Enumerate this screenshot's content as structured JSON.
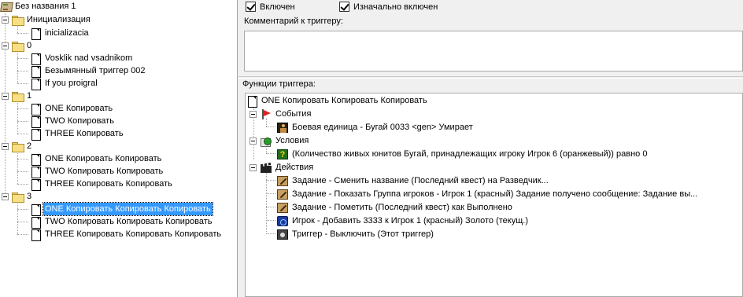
{
  "tree": {
    "map_name": "Без названия 1",
    "categories": [
      {
        "label": "Инициализация",
        "triggers": [
          "inicializacia"
        ]
      },
      {
        "label": "0",
        "triggers": [
          "Vosklik nad vsadnikom",
          "Безымянный триггер 002",
          "If you proigral"
        ]
      },
      {
        "label": "1",
        "triggers": [
          "ONE Копировать",
          "TWO Копировать",
          "THREE Копировать"
        ]
      },
      {
        "label": "2",
        "triggers": [
          "ONE Копировать Копировать",
          "TWO Копировать Копировать",
          "THREE Копировать Копировать"
        ]
      },
      {
        "label": "3",
        "triggers": [
          "ONE Копировать Копировать Копировать",
          "TWO Копировать Копировать Копировать",
          "THREE Копировать Копировать Копировать"
        ]
      }
    ],
    "selected": "ONE Копировать Копировать Копировать"
  },
  "editor": {
    "enabled_label": "Включен",
    "enabled_checked": true,
    "initially_on_label": "Изначально включен",
    "initially_on_checked": true,
    "comment_label": "Комментарий к триггеру:",
    "comment_value": "",
    "functions_label": "Функции триггера:",
    "trigger_name": "ONE Копировать Копировать Копировать",
    "events_label": "События",
    "events": [
      "Боевая единица - Бугай 0033 <gen> Умирает"
    ],
    "conditions_label": "Условия",
    "conditions": [
      "(Количество живых юнитов Бугай, принадлежащих игроку Игрок 6 (оранжевый)) равно 0"
    ],
    "actions_label": "Действия",
    "actions": [
      "Задание - Сменить название (Последний квест) на Разведчик...",
      "Задание - Показать Группа игроков - Игрок 1 (красный) Задание получено сообщение: Задание вы...",
      "Задание - Пометить (Последний квест) как Выполнено",
      "Игрок - Добавить 3333 к Игрок 1 (красный) Золото (текущ.)",
      "Триггер - Выключить (Этот триггер)"
    ]
  }
}
